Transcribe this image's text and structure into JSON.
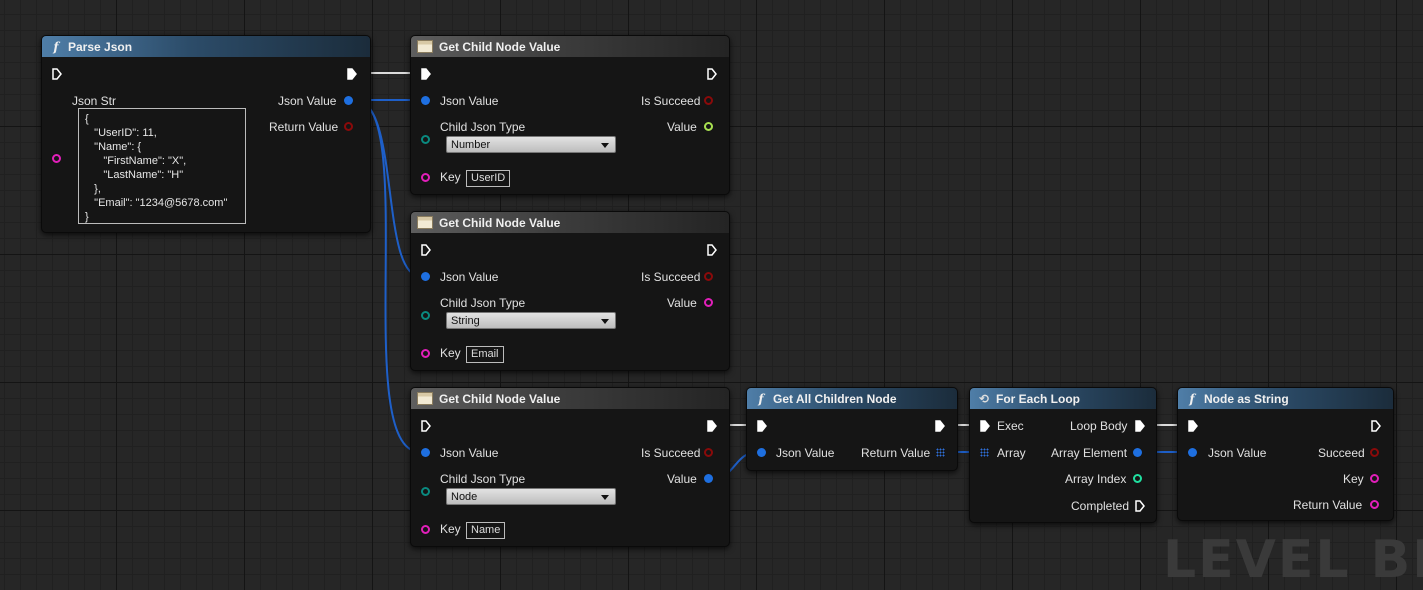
{
  "watermark": "LEVEL BLU",
  "colors": {
    "exec": "#ffffff",
    "json": "#1e6fe0",
    "string": "#e21fba",
    "bool": "#8a0a0a",
    "int": "#20e0a0",
    "number_out": "#a8e050",
    "type_pin": "#0a8a80"
  },
  "nodes": {
    "parse_json": {
      "title": "Parse Json",
      "json_str_label": "Json Str",
      "json_value_label": "Json Value",
      "return_value_label": "Return Value",
      "json_text": "{\n   \"UserID\": 11,\n   \"Name\": {\n      \"FirstName\": \"X\",\n      \"LastName\": \"H\"\n   },\n   \"Email\": \"1234@5678.com\"\n}"
    },
    "get_child_1": {
      "title": "Get Child Node Value",
      "json_value_label": "Json Value",
      "is_succeed_label": "Is Succeed",
      "child_type_label": "Child Json Type",
      "value_label": "Value",
      "type_selected": "Number",
      "key_label": "Key",
      "key_value": "UserID"
    },
    "get_child_2": {
      "title": "Get Child Node Value",
      "json_value_label": "Json Value",
      "is_succeed_label": "Is Succeed",
      "child_type_label": "Child Json Type",
      "value_label": "Value",
      "type_selected": "String",
      "key_label": "Key",
      "key_value": "Email"
    },
    "get_child_3": {
      "title": "Get Child Node Value",
      "json_value_label": "Json Value",
      "is_succeed_label": "Is Succeed",
      "child_type_label": "Child Json Type",
      "value_label": "Value",
      "type_selected": "Node",
      "key_label": "Key",
      "key_value": "Name"
    },
    "get_all_children": {
      "title": "Get All Children Node",
      "json_value_label": "Json Value",
      "return_value_label": "Return Value"
    },
    "for_each": {
      "title": "For Each Loop",
      "exec_label": "Exec",
      "array_label": "Array",
      "loop_body_label": "Loop Body",
      "array_element_label": "Array Element",
      "array_index_label": "Array Index",
      "completed_label": "Completed"
    },
    "node_as_string": {
      "title": "Node as String",
      "json_value_label": "Json Value",
      "succeed_label": "Succeed",
      "key_label": "Key",
      "return_value_label": "Return Value"
    }
  }
}
